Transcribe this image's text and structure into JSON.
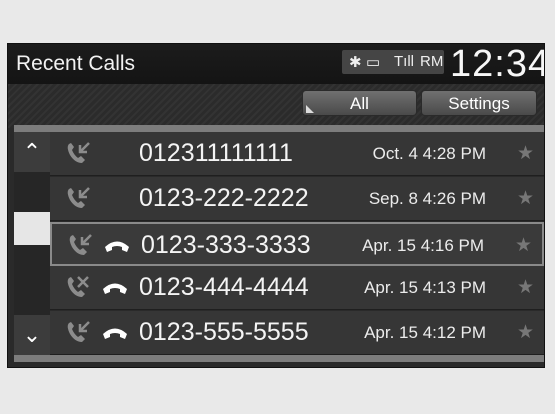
{
  "header": {
    "title": "Recent Calls",
    "clock": "12:34",
    "status": {
      "bt": "✱",
      "battery": "▭",
      "signal": "Tıll",
      "roaming": "RM"
    }
  },
  "toolbar": {
    "all_label": "All",
    "settings_label": "Settings"
  },
  "calls": [
    {
      "number": "012311111111",
      "datetime": "Oct. 4 4:28 PM",
      "type": "received",
      "handset": false,
      "star": "★"
    },
    {
      "number": "0123-222-2222",
      "datetime": "Sep. 8 4:26 PM",
      "type": "received",
      "handset": false,
      "star": "★"
    },
    {
      "number": "0123-333-3333",
      "datetime": "Apr. 15 4:16 PM",
      "type": "received",
      "handset": true,
      "star": "★"
    },
    {
      "number": "0123-444-4444",
      "datetime": "Apr. 15 4:13 PM",
      "type": "missed",
      "handset": true,
      "star": "★"
    },
    {
      "number": "0123-555-5555",
      "datetime": "Apr. 15 4:12 PM",
      "type": "received",
      "handset": true,
      "star": "★"
    }
  ],
  "scroll": {
    "up": "⌃",
    "down": "⌄"
  },
  "colors": {
    "background": "#2a2a2a",
    "row": "#363636",
    "icon": "#8c8c8c",
    "text": "#f4f4f4"
  }
}
